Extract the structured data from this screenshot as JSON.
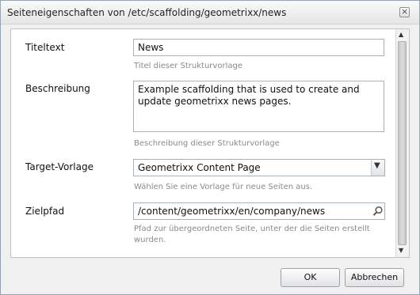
{
  "dialog": {
    "title": "Seiteneigenschaften von /etc/scaffolding/geometrixx/news",
    "close_glyph": "×"
  },
  "form": {
    "title_text": {
      "label": "Titeltext",
      "value": "News",
      "hint": "Titel dieser Strukturvorlage"
    },
    "description": {
      "label": "Beschreibung",
      "value": "Example scaffolding that is used to create and update geometrixx news pages.",
      "hint": "Beschreibung dieser Strukturvorlage"
    },
    "target_template": {
      "label": "Target-Vorlage",
      "value": "Geometrixx Content Page",
      "hint": "Wählen Sie eine Vorlage für neue Seiten aus."
    },
    "target_path": {
      "label": "Zielpfad",
      "value": "/content/geometrixx/en/company/news",
      "hint": "Pfad zur übergeordneten Seite, unter der die Seiten erstellt wurden."
    }
  },
  "buttons": {
    "ok": "OK",
    "cancel": "Abbrechen"
  }
}
